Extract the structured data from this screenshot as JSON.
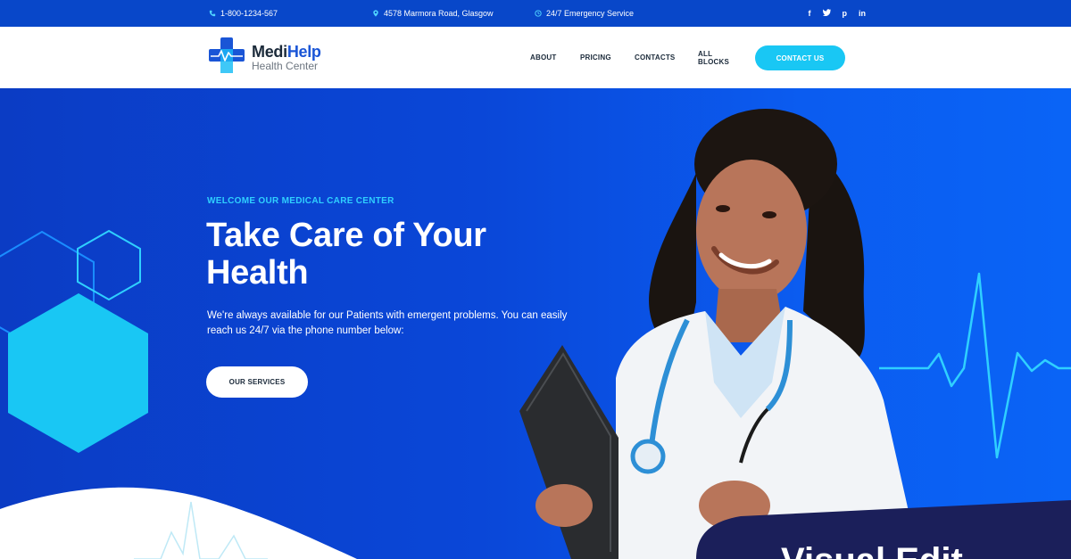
{
  "topbar": {
    "phone": "1-800-1234-567",
    "address": "4578 Marmora Road, Glasgow",
    "hours": "24/7 Emergency Service",
    "social_icons": [
      "facebook-icon",
      "twitter-icon",
      "pinterest-icon",
      "linkedin-icon"
    ],
    "social_glyphs": [
      "f",
      "𝕏",
      "p",
      "in"
    ]
  },
  "header": {
    "logo_name_a": "Medi",
    "logo_name_b": "Help",
    "logo_sub": "Health Center",
    "nav": [
      "ABOUT",
      "PRICING",
      "CONTACTS",
      "ALL BLOCKS"
    ],
    "cta_label": "CONTACT US"
  },
  "hero": {
    "eyebrow": "WELCOME OUR MEDICAL CARE CENTER",
    "title": "Take Care of Your Health",
    "description": "We're always available for our Patients with emergent problems. You can easily reach us 24/7 via the phone number below:",
    "button_label": "OUR SERVICES",
    "corner_text": "Visual Edit"
  },
  "colors": {
    "accent": "#19c7f4",
    "brand_blue": "#0a47d8",
    "topbar": "#0847c9",
    "dark_panel": "#1b1f5a"
  }
}
